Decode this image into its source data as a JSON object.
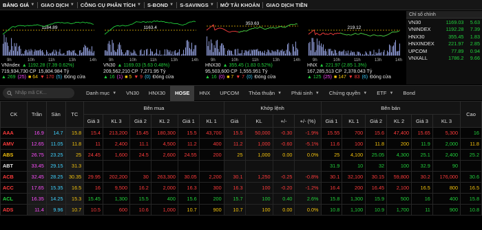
{
  "nav": [
    {
      "label": "BẢNG GIÁ",
      "caret": true,
      "active": true
    },
    {
      "label": "GIAO DỊCH",
      "caret": true
    },
    {
      "label": "CÔNG CỤ PHÂN TÍCH",
      "caret": true
    },
    {
      "label": "S-BOND",
      "caret": true
    },
    {
      "label": "S-SAVINGS",
      "caret": true
    },
    {
      "label": "MỞ TÀI KHOẢN",
      "caret": false
    },
    {
      "label": "GIAO DỊCH TIỀN",
      "caret": false
    }
  ],
  "panels": [
    {
      "name": "VNIndex",
      "change_text": "▲ 1192.28 (7.39 0.62%)",
      "dir": "up",
      "ref_label": "1184.89",
      "volume": "719,934,730 CP",
      "value": "15,804.984 Tỷ",
      "breadth": {
        "up": "▲ 269",
        "up_sub": "(25)",
        "ref": "■ 64",
        "down": "▼ 170",
        "down_sub": "(5)",
        "status": "Đóng cửa"
      },
      "times": [
        "9h",
        "10h",
        "11h",
        "13h",
        "14h"
      ]
    },
    {
      "name": "VN30",
      "change_text": "▲ 1169.03 (5.63 0.48%)",
      "dir": "up",
      "ref_label": "1163.4",
      "volume": "209,562,210 CP",
      "value": "7,271.95 Tỷ",
      "breadth": {
        "up": "▲ 16",
        "up_sub": "(1)",
        "ref": "■ 5",
        "down": "▼ 9",
        "down_sub": "(0)",
        "status": "Đóng cửa"
      },
      "times": [
        "9h",
        "10h",
        "11h",
        "13h",
        "14h"
      ]
    },
    {
      "name": "HNX30",
      "change_text": "▲ 355.45 (1.83 0.52%)",
      "dir": "up",
      "ref_label": "353.63",
      "volume": "95,503,600 CP",
      "value": "1,555.951 Tỷ",
      "breadth": {
        "up": "▲ 16",
        "up_sub": "(0)",
        "ref": "■ 7",
        "down": "▼ 7",
        "down_sub": "(0)",
        "status": "Đóng cửa"
      },
      "times": [
        "9h",
        "10h",
        "11h",
        "13h",
        "14h"
      ]
    },
    {
      "name": "HNX",
      "change_text": "▲ 221.97 (2.85 1.3%)",
      "dir": "up",
      "ref_label": "219.12",
      "volume": "167,285,513 CP",
      "value": "2,378.043 Tỷ",
      "breadth": {
        "up": "▲ 125",
        "up_sub": "(25)",
        "ref": "■ 147",
        "down": "▼ 83",
        "down_sub": "(6)",
        "status": "Đóng cửa"
      },
      "times": [
        "9h",
        "10h",
        "11h",
        "13h",
        "14h"
      ]
    }
  ],
  "index_box": {
    "header": "Chỉ số chính",
    "rows": [
      {
        "name": "VN30",
        "value": "1169.03",
        "change": "5.63",
        "dir": "up"
      },
      {
        "name": "VNINDEX",
        "value": "1192.28",
        "change": "7.39",
        "dir": "up"
      },
      {
        "name": "HNX30",
        "value": "355.45",
        "change": "1.83",
        "dir": "up"
      },
      {
        "name": "HNXINDEX",
        "value": "221.97",
        "change": "2.85",
        "dir": "up"
      },
      {
        "name": "UPCOM",
        "value": "77.89",
        "change": "0.94",
        "dir": "up"
      },
      {
        "name": "VNXALL",
        "value": "1786.2",
        "change": "9.66",
        "dir": "up"
      }
    ]
  },
  "search": {
    "placeholder": "Nhập mã CK..."
  },
  "tabs": [
    {
      "label": "Danh mục",
      "caret": true
    },
    {
      "label": "VN30",
      "caret": false
    },
    {
      "label": "HNX30",
      "caret": false
    },
    {
      "label": "HOSE",
      "caret": false,
      "active": true
    },
    {
      "label": "HNX",
      "caret": false
    },
    {
      "label": "UPCOM",
      "caret": false
    },
    {
      "label": "Thỏa thuận",
      "caret": true
    },
    {
      "label": "Phái sinh",
      "caret": true
    },
    {
      "label": "Chứng quyền",
      "caret": true
    },
    {
      "label": "ETF",
      "caret": true
    },
    {
      "label": "Bond",
      "caret": false
    }
  ],
  "table": {
    "group_headers": {
      "buy": "Bên mua",
      "match": "Khớp lệnh",
      "sell": "Bên bán"
    },
    "headers": [
      "CK",
      "Trần",
      "Sàn",
      "TC",
      "Giá 3",
      "KL 3",
      "Giá 2",
      "KL 2",
      "Giá 1",
      "KL 1",
      "Giá",
      "KL",
      "+/-",
      "+/- (%)",
      "Giá 1",
      "KL 1",
      "Giá 2",
      "KL 2",
      "Giá 3",
      "KL 3",
      "Cao"
    ],
    "rows": [
      {
        "c": [
          "AAA",
          "16.9",
          "14.7",
          "15.8",
          "15.4",
          "213,200",
          "15.45",
          "180,300",
          "15.5",
          "43,700",
          "15.5",
          "50,000",
          "-0.30",
          "-1.9%",
          "15.55",
          "700",
          "15.6",
          "47,400",
          "15.65",
          "5,300",
          "16"
        ],
        "k": [
          "dn",
          "cl",
          "fl",
          "rf",
          "dn",
          "dn",
          "dn",
          "dn",
          "dn",
          "dn",
          "dn",
          "dn",
          "dn",
          "dn",
          "dn",
          "dn",
          "dn",
          "dn",
          "dn",
          "dn",
          "up"
        ]
      },
      {
        "c": [
          "AMV",
          "12.65",
          "11.05",
          "11.8",
          "11",
          "2,400",
          "11.1",
          "4,500",
          "11.2",
          "400",
          "11.2",
          "1,000",
          "-0.60",
          "-5.1%",
          "11.6",
          "100",
          "11.8",
          "200",
          "11.9",
          "2,000",
          "11.8"
        ],
        "k": [
          "dn",
          "cl",
          "fl",
          "rf",
          "dn",
          "dn",
          "dn",
          "dn",
          "dn",
          "dn",
          "dn",
          "dn",
          "dn",
          "dn",
          "dn",
          "dn",
          "rf",
          "rf",
          "up",
          "up",
          "rf"
        ]
      },
      {
        "c": [
          "ABS",
          "26.75",
          "23.25",
          "25",
          "24.45",
          "1,600",
          "24.5",
          "2,600",
          "24.55",
          "200",
          "25",
          "1,000",
          "0.00",
          "0.0%",
          "25",
          "4,100",
          "25.05",
          "4,300",
          "25.1",
          "2,400",
          "25.2"
        ],
        "k": [
          "rf",
          "cl",
          "fl",
          "rf",
          "dn",
          "dn",
          "dn",
          "dn",
          "dn",
          "dn",
          "rf",
          "rf",
          "rf",
          "rf",
          "rf",
          "rf",
          "up",
          "up",
          "up",
          "up",
          "up"
        ]
      },
      {
        "c": [
          "ABT",
          "33.45",
          "29.15",
          "31.3",
          "",
          "",
          "",
          "",
          "",
          "",
          "",
          "",
          "",
          "",
          "31.9",
          "10",
          "32",
          "100",
          "32.9",
          "90",
          ""
        ],
        "k": [
          "wh",
          "cl",
          "fl",
          "rf",
          "dn",
          "dn",
          "dn",
          "dn",
          "dn",
          "dn",
          "dn",
          "dn",
          "dn",
          "dn",
          "up",
          "up",
          "up",
          "up",
          "up",
          "up",
          "up"
        ]
      },
      {
        "c": [
          "ACB",
          "32.45",
          "28.25",
          "30.35",
          "29.95",
          "202,200",
          "30",
          "263,300",
          "30.05",
          "2,200",
          "30.1",
          "1,250",
          "-0.25",
          "-0.8%",
          "30.1",
          "32,100",
          "30.15",
          "59,800",
          "30.2",
          "176,000",
          "30.6"
        ],
        "k": [
          "dn",
          "cl",
          "fl",
          "rf",
          "dn",
          "dn",
          "dn",
          "dn",
          "dn",
          "dn",
          "dn",
          "dn",
          "dn",
          "dn",
          "dn",
          "dn",
          "dn",
          "dn",
          "dn",
          "dn",
          "up"
        ]
      },
      {
        "c": [
          "ACC",
          "17.65",
          "15.35",
          "16.5",
          "16",
          "9,500",
          "16.2",
          "2,000",
          "16.3",
          "300",
          "16.3",
          "100",
          "-0.20",
          "-1.2%",
          "16.4",
          "200",
          "16.45",
          "2,100",
          "16.5",
          "800",
          "16.5"
        ],
        "k": [
          "dn",
          "cl",
          "fl",
          "rf",
          "dn",
          "dn",
          "dn",
          "dn",
          "dn",
          "dn",
          "dn",
          "dn",
          "dn",
          "dn",
          "dn",
          "dn",
          "dn",
          "dn",
          "rf",
          "rf",
          "rf"
        ]
      },
      {
        "c": [
          "ACL",
          "16.35",
          "14.25",
          "15.3",
          "15.45",
          "1,300",
          "15.5",
          "400",
          "15.6",
          "200",
          "15.7",
          "100",
          "0.40",
          "2.6%",
          "15.8",
          "1,300",
          "15.9",
          "500",
          "16",
          "400",
          "15.8"
        ],
        "k": [
          "up",
          "cl",
          "fl",
          "rf",
          "up",
          "up",
          "up",
          "up",
          "up",
          "up",
          "up",
          "up",
          "up",
          "up",
          "up",
          "up",
          "up",
          "up",
          "up",
          "up",
          "up"
        ]
      },
      {
        "c": [
          "ADS",
          "11.4",
          "9.96",
          "10.7",
          "10.5",
          "600",
          "10.6",
          "1,000",
          "10.7",
          "900",
          "10.7",
          "100",
          "0.00",
          "0.0%",
          "10.8",
          "1,100",
          "10.9",
          "1,700",
          "11",
          "900",
          "10.8"
        ],
        "k": [
          "dn",
          "cl",
          "fl",
          "rf",
          "dn",
          "dn",
          "dn",
          "dn",
          "rf",
          "rf",
          "rf",
          "rf",
          "rf",
          "rf",
          "up",
          "up",
          "up",
          "up",
          "up",
          "up",
          "up"
        ]
      }
    ]
  }
}
